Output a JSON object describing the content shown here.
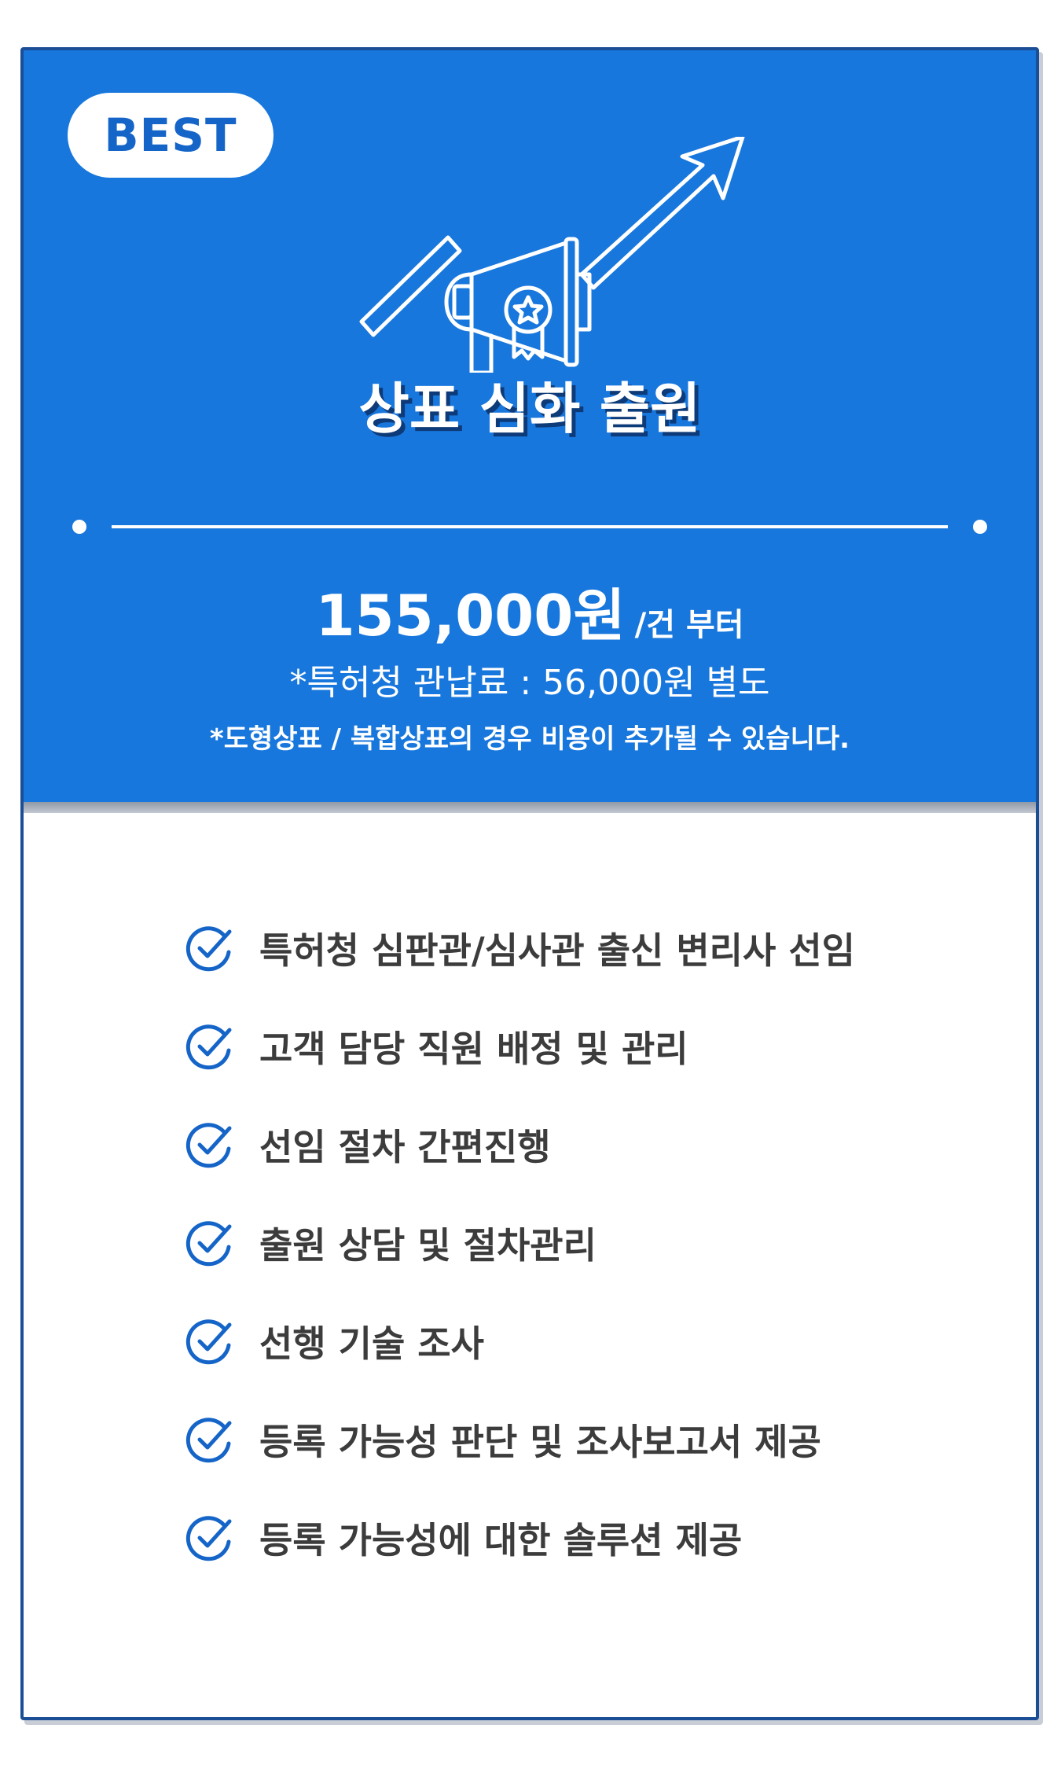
{
  "badge": {
    "label": "BEST"
  },
  "hero": {
    "icon": "megaphone-growth-arrow-icon"
  },
  "title": "상표 심화 출원",
  "price": {
    "amount": "155,000원",
    "unit": "/건 부터"
  },
  "fee_note": "*특허청 관납료 : 56,000원 별도",
  "extra_note": "*도형상표 / 복합상표의 경우 비용이 추가될 수 있습니다.",
  "features": [
    {
      "label": "특허청 심판관/심사관 출신 변리사 선임",
      "icon": "check-circle-icon"
    },
    {
      "label": "고객 담당 직원 배정 및 관리",
      "icon": "check-circle-icon"
    },
    {
      "label": "선임 절차 간편진행",
      "icon": "check-circle-icon"
    },
    {
      "label": "출원 상담 및 절차관리",
      "icon": "check-circle-icon"
    },
    {
      "label": "선행 기술 조사",
      "icon": "check-circle-icon"
    },
    {
      "label": "등록 가능성 판단 및 조사보고서 제공",
      "icon": "check-circle-icon"
    },
    {
      "label": "등록 가능성에 대한 솔루션 제공",
      "icon": "check-circle-icon"
    }
  ],
  "colors": {
    "primary_blue": "#1877dc",
    "border_navy": "#1c4e96",
    "badge_text": "#1565c8",
    "feature_text": "#3c3c3c",
    "check_blue": "#1565c8"
  }
}
